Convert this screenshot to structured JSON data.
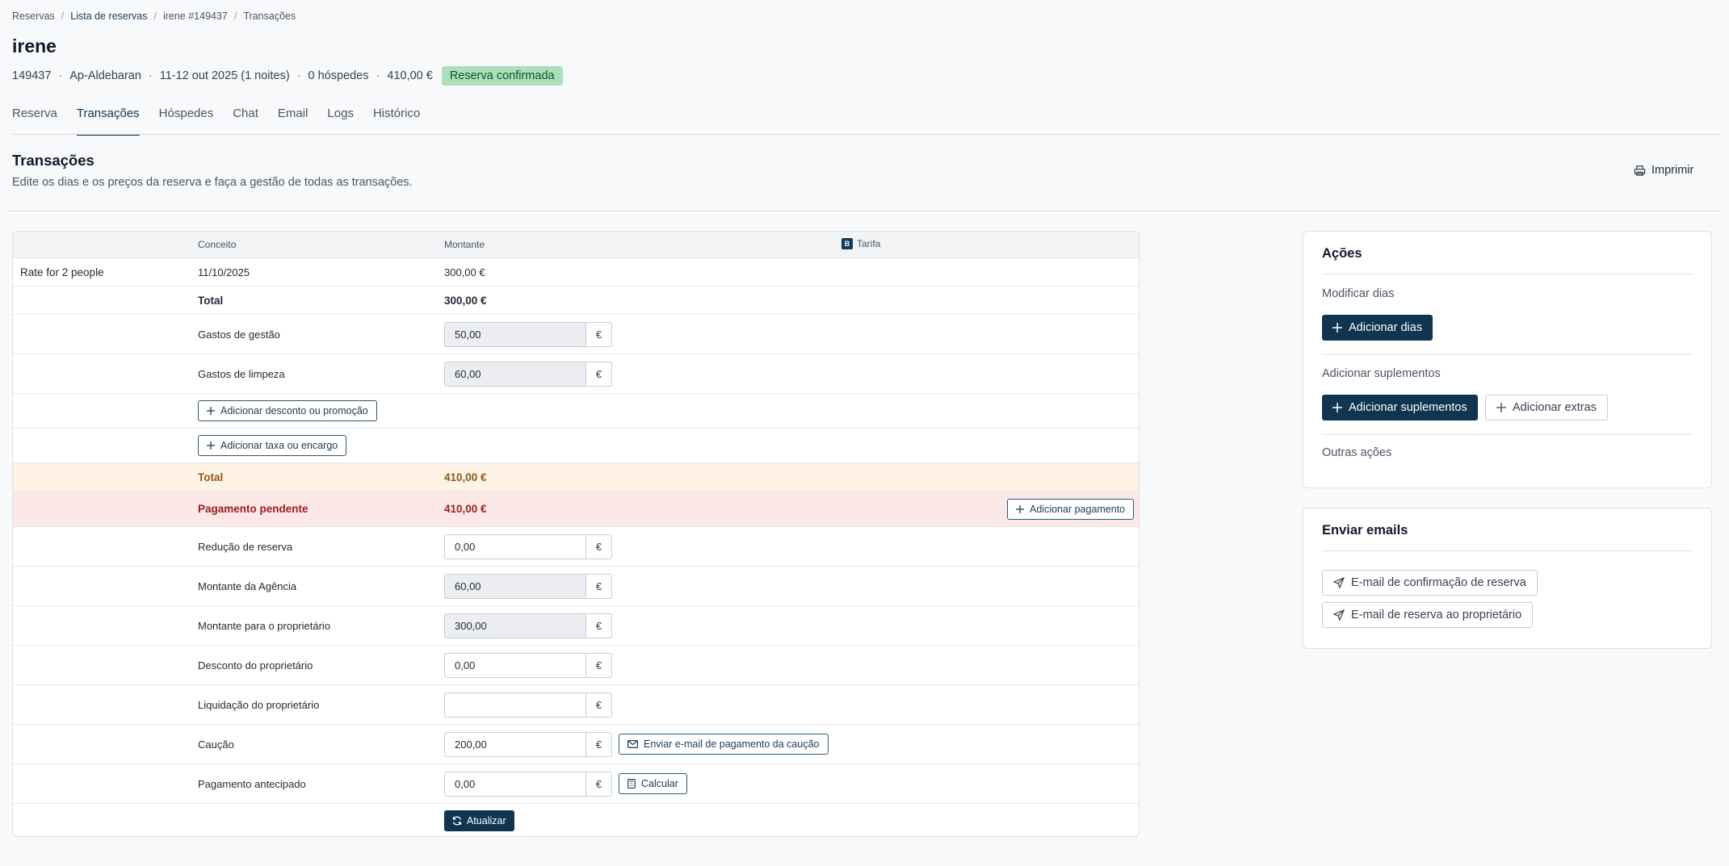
{
  "breadcrumb": [
    {
      "label": "Reservas"
    },
    {
      "label": "Lista de reservas"
    },
    {
      "label": "irene #149437"
    },
    {
      "label": "Transações"
    }
  ],
  "page_title": "irene",
  "meta": {
    "id": "149437",
    "apartment": "Ap-Aldebaran",
    "dates": "11-12 out 2025 (1 noites)",
    "guests": "0 hóspedes",
    "amount": "410,00 €",
    "status": "Reserva confirmada"
  },
  "tabs": [
    {
      "label": "Reserva",
      "active": false
    },
    {
      "label": "Transações",
      "active": true
    },
    {
      "label": "Hóspedes",
      "active": false
    },
    {
      "label": "Chat",
      "active": false
    },
    {
      "label": "Email",
      "active": false
    },
    {
      "label": "Logs",
      "active": false
    },
    {
      "label": "Histórico",
      "active": false
    }
  ],
  "section": {
    "title": "Transações",
    "subtitle": "Edite os dias e os preços da reserva e faça a gestão de todas as transações.",
    "print_label": "Imprimir"
  },
  "table": {
    "headers": {
      "concept": "Conceito",
      "amount": "Montante",
      "rate": "Tarifa",
      "rate_badge": "B"
    },
    "rate_row": {
      "name": "Rate for 2 people",
      "date": "11/10/2025",
      "amount": "300,00 €"
    },
    "subtotal": {
      "label": "Total",
      "amount": "300,00 €"
    },
    "fees": [
      {
        "label": "Gastos de gestão",
        "value": "50,00",
        "unit": "€"
      },
      {
        "label": "Gastos de limpeza",
        "value": "60,00",
        "unit": "€"
      }
    ],
    "add_discount_label": "Adicionar desconto ou promoção",
    "add_tax_label": "Adicionar taxa ou encargo",
    "total": {
      "label": "Total",
      "amount": "410,00 €"
    },
    "pending": {
      "label": "Pagamento pendente",
      "amount": "410,00 €",
      "button_label": "Adicionar pagamento"
    },
    "fields": [
      {
        "label": "Redução de reserva",
        "value": "0,00",
        "unit": "€"
      },
      {
        "label": "Montante da Agência",
        "value": "60,00",
        "unit": "€"
      },
      {
        "label": "Montante para o proprietário",
        "value": "300,00",
        "unit": "€"
      },
      {
        "label": "Desconto do proprietário",
        "value": "0,00",
        "unit": "€"
      },
      {
        "label": "Liquidação do proprietário",
        "value": "",
        "unit": "€"
      },
      {
        "label": "Caução",
        "value": "200,00",
        "unit": "€"
      },
      {
        "label": "Pagamento antecipado",
        "value": "0,00",
        "unit": "€"
      }
    ],
    "deposit_email_label": "Enviar e-mail de pagamento da caução",
    "calculate_label": "Calcular",
    "update_label": "Atualizar"
  },
  "actions": {
    "title": "Ações",
    "modify_days_label": "Modificar dias",
    "add_days_label": "Adicionar dias",
    "add_supplements_section": "Adicionar suplementos",
    "add_supplements_label": "Adicionar suplementos",
    "add_extras_label": "Adicionar extras",
    "other_actions_label": "Outras ações"
  },
  "emails": {
    "title": "Enviar emails",
    "confirmation_label": "E-mail de confirmação de reserva",
    "owner_label": "E-mail de reserva ao proprietário"
  },
  "colors": {
    "primary": "#0f3551",
    "badge_bg": "#a9dfb9",
    "total_bg": "#fff3e5",
    "pending_bg": "#fde8e8"
  }
}
